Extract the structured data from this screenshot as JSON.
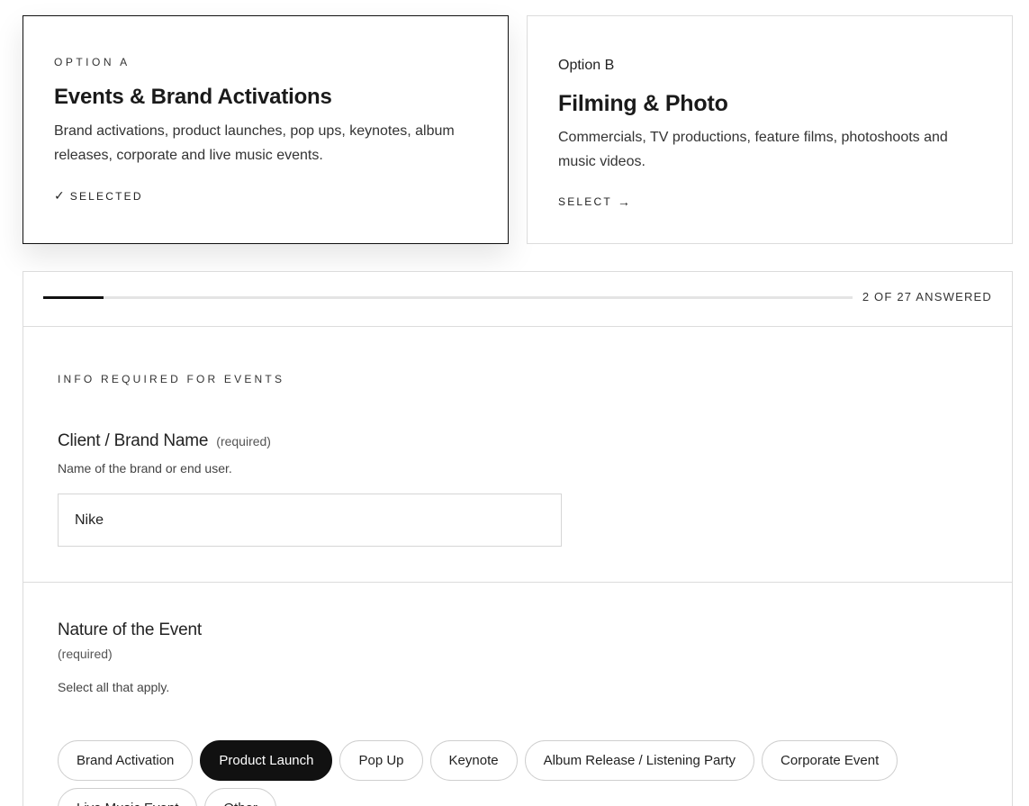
{
  "options": {
    "a": {
      "eyebrow": "OPTION A",
      "title": "Events & Brand Activations",
      "description": "Brand activations, product launches, pop ups, keynotes, album releases, corporate and live music events.",
      "action_label": "SELECTED",
      "action_icon": "✓",
      "selected": true
    },
    "b": {
      "eyebrow": "Option B",
      "title": "Filming & Photo",
      "description": "Commercials, TV productions, feature films, photoshoots and music videos.",
      "action_label": "SELECT",
      "action_icon": "→",
      "selected": false
    }
  },
  "progress": {
    "text": "2 OF 27 ANSWERED",
    "answered": 2,
    "total": 27,
    "fraction": 0.074
  },
  "form": {
    "section_heading": "INFO REQUIRED FOR EVENTS",
    "client_field": {
      "label": "Client / Brand Name",
      "required_text": "(required)",
      "help": "Name of the brand or end user.",
      "value": "Nike"
    },
    "nature_field": {
      "label": "Nature of the Event",
      "required_text": "(required)",
      "help": "Select all that apply.",
      "options": [
        {
          "label": "Brand Activation",
          "selected": false
        },
        {
          "label": "Product Launch",
          "selected": true
        },
        {
          "label": "Pop Up",
          "selected": false
        },
        {
          "label": "Keynote",
          "selected": false
        },
        {
          "label": "Album Release / Listening Party",
          "selected": false
        },
        {
          "label": "Corporate Event",
          "selected": false
        },
        {
          "label": "Live Music Event",
          "selected": false
        },
        {
          "label": "Other",
          "selected": false
        }
      ]
    }
  },
  "colors": {
    "accent": "#111111",
    "border": "#dcdcdc",
    "track": "#e4e4e4"
  }
}
